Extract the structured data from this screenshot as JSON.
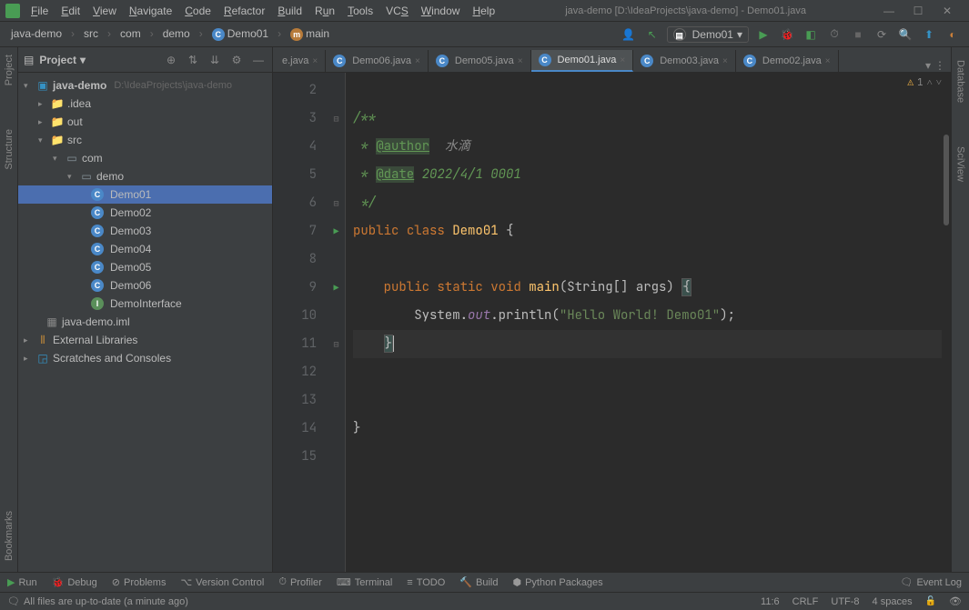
{
  "title": "java-demo [D:\\IdeaProjects\\java-demo] - Demo01.java",
  "menu": [
    "File",
    "Edit",
    "View",
    "Navigate",
    "Code",
    "Refactor",
    "Build",
    "Run",
    "Tools",
    "VCS",
    "Window",
    "Help"
  ],
  "breadcrumbs": {
    "project": "java-demo",
    "src": "src",
    "com": "com",
    "demo": "demo",
    "class": "Demo01",
    "method": "main"
  },
  "runconfig": "Demo01",
  "tree": {
    "header": "Project",
    "root_name": "java-demo",
    "root_path": "D:\\IdeaProjects\\java-demo",
    "idea": ".idea",
    "out": "out",
    "src": "src",
    "com": "com",
    "demo": "demo",
    "items": [
      "Demo01",
      "Demo02",
      "Demo03",
      "Demo04",
      "Demo05",
      "Demo06",
      "DemoInterface"
    ],
    "iml": "java-demo.iml",
    "ext": "External Libraries",
    "scratch": "Scratches and Consoles"
  },
  "left_tabs": {
    "project": "Project",
    "structure": "Structure",
    "bookmarks": "Bookmarks"
  },
  "right_tabs": {
    "database": "Database",
    "sciview": "SciView"
  },
  "tabs": [
    {
      "label": "e.java",
      "active": false,
      "partial": true
    },
    {
      "label": "Demo06.java",
      "active": false
    },
    {
      "label": "Demo05.java",
      "active": false
    },
    {
      "label": "Demo01.java",
      "active": true
    },
    {
      "label": "Demo03.java",
      "active": false
    },
    {
      "label": "Demo02.java",
      "active": false
    }
  ],
  "gutter_start": 2,
  "gutter_end": 15,
  "code": {
    "l2": "",
    "l3_a": "/**",
    "l4_a": " * ",
    "l4_b": "@author",
    "l4_c": "  水滴",
    "l5_a": " * ",
    "l5_b": "@date",
    "l5_c": " 2022/4/1 0001",
    "l6_a": " */",
    "l7_a": "public ",
    "l7_b": "class ",
    "l7_c": "Demo01 ",
    "l7_d": "{",
    "l8": "",
    "l9_a": "    public ",
    "l9_b": "static ",
    "l9_c": "void ",
    "l9_d": "main",
    "l9_e": "(String[] args) ",
    "l9_f": "{",
    "l10_a": "        System.",
    "l10_b": "out",
    "l10_c": ".println(",
    "l10_d": "\"Hello World! Demo01\"",
    "l10_e": ");",
    "l11_a": "    ",
    "l11_b": "}",
    "l12": "",
    "l13": "",
    "l14_a": "}",
    "l15": ""
  },
  "inspection": {
    "warnings": "1"
  },
  "bottom": {
    "run": "Run",
    "debug": "Debug",
    "problems": "Problems",
    "vcs": "Version Control",
    "profiler": "Profiler",
    "terminal": "Terminal",
    "todo": "TODO",
    "build": "Build",
    "python": "Python Packages",
    "eventlog": "Event Log"
  },
  "status": {
    "msg": "All files are up-to-date (a minute ago)",
    "pos": "11:6",
    "eol": "CRLF",
    "enc": "UTF-8",
    "indent": "4 spaces"
  }
}
